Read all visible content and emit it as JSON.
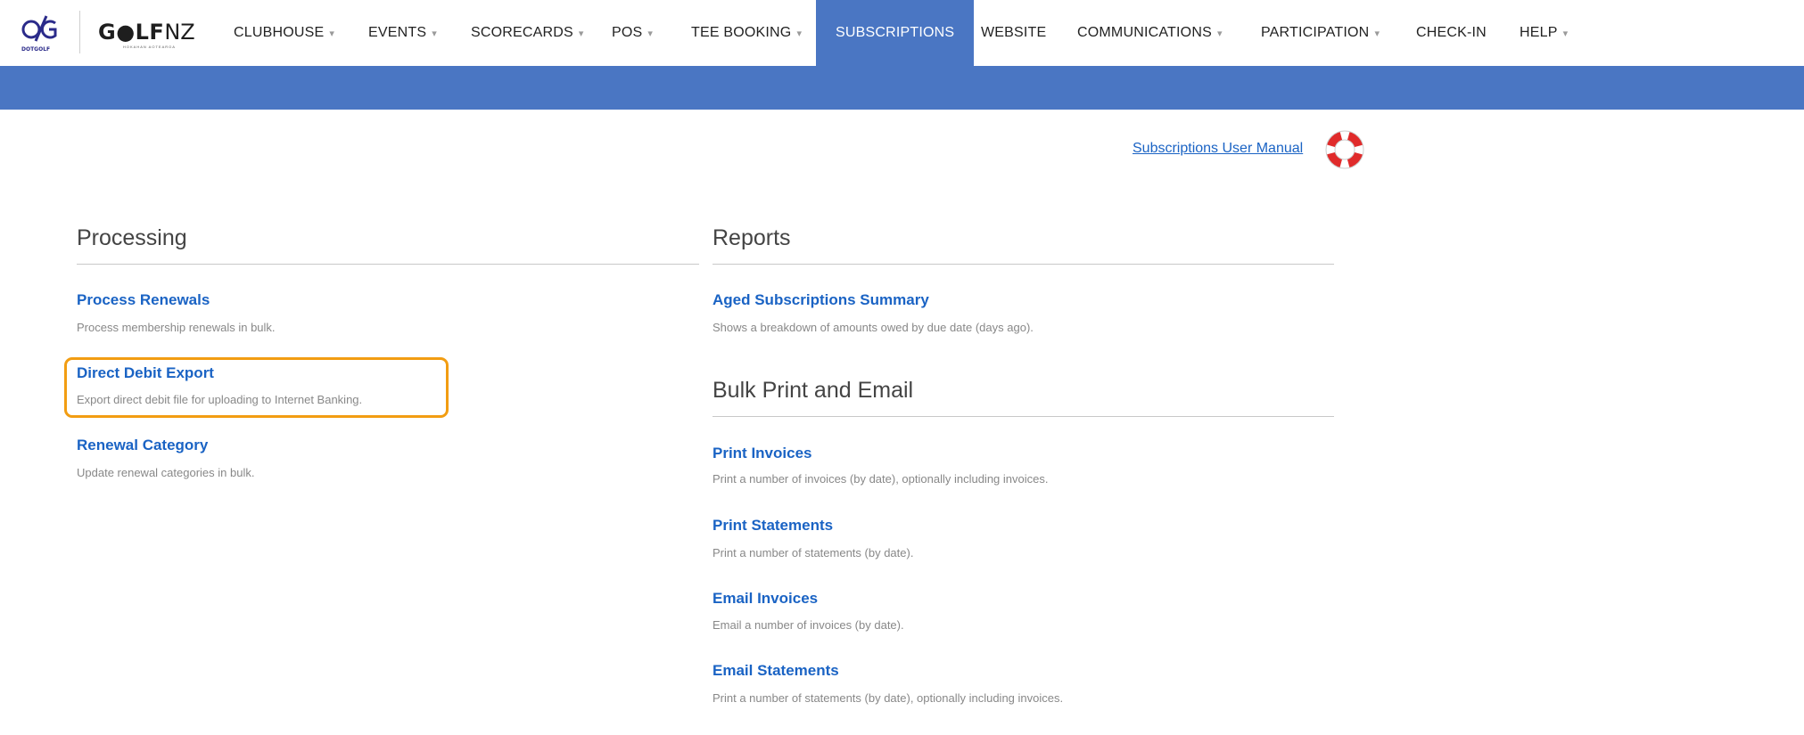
{
  "brand": {
    "dotgolf_label": "DOTGOLF",
    "golfnz_main": "G●LF",
    "golfnz_nz": "NZ",
    "golfnz_sub": "HOKAHAN AOTEAROA"
  },
  "nav": {
    "items": [
      {
        "label": "CLUBHOUSE",
        "dropdown": true
      },
      {
        "label": "EVENTS",
        "dropdown": true
      },
      {
        "label": "SCORECARDS",
        "dropdown": true
      },
      {
        "label": "POS",
        "dropdown": true
      },
      {
        "label": "TEE BOOKING",
        "dropdown": true
      },
      {
        "label": "SUBSCRIPTIONS",
        "dropdown": false,
        "active": true
      },
      {
        "label": "WEBSITE",
        "dropdown": false
      },
      {
        "label": "COMMUNICATIONS",
        "dropdown": true
      },
      {
        "label": "PARTICIPATION",
        "dropdown": true
      },
      {
        "label": "CHECK-IN",
        "dropdown": false
      },
      {
        "label": "HELP",
        "dropdown": true
      }
    ],
    "caret": "▾"
  },
  "manual_link": "Subscriptions User Manual",
  "processing": {
    "title": "Processing",
    "items": [
      {
        "title": "Process Renewals",
        "desc": "Process membership renewals in bulk."
      },
      {
        "title": "Direct Debit Export",
        "desc": "Export direct debit file for uploading to Internet Banking."
      },
      {
        "title": "Renewal Category",
        "desc": "Update renewal categories in bulk."
      }
    ]
  },
  "reports": {
    "title": "Reports",
    "items": [
      {
        "title": "Aged Subscriptions Summary",
        "desc": "Shows a breakdown of amounts owed by due date (days ago)."
      }
    ]
  },
  "bulk": {
    "title": "Bulk Print and Email",
    "items": [
      {
        "title": "Print Invoices",
        "desc": "Print a number of invoices (by date), optionally including invoices."
      },
      {
        "title": "Print Statements",
        "desc": "Print a number of statements (by date)."
      },
      {
        "title": "Email Invoices",
        "desc": "Email a number of invoices (by date)."
      },
      {
        "title": "Email Statements",
        "desc": "Print a number of statements (by date), optionally including invoices."
      }
    ]
  },
  "colors": {
    "accent": "#4a76c3",
    "link": "#1a63c4",
    "highlight": "#f29d12"
  },
  "icons": [
    "dotgolf-logo",
    "golfnz-logo",
    "lifebuoy-icon",
    "chevron-down-icon"
  ]
}
